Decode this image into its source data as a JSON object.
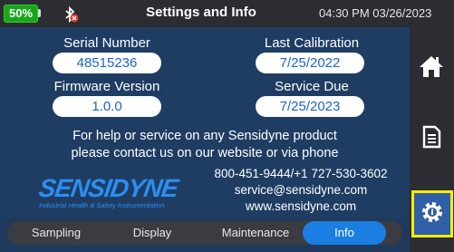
{
  "header": {
    "battery_percent": "50%",
    "battery_level": 0.5,
    "title": "Settings and Info",
    "clock": "04:30 PM 03/26/2023"
  },
  "device": {
    "serial_label": "Serial Number",
    "serial_value": "48515236",
    "calibration_label": "Last Calibration",
    "calibration_value": "7/25/2022",
    "firmware_label": "Firmware Version",
    "firmware_value": "1.0.0",
    "service_label": "Service Due",
    "service_value": "7/25/2023"
  },
  "help": {
    "line1": "For help or service on any Sensidyne product",
    "line2": "please contact us on our website or via phone"
  },
  "logo": {
    "name": "SENSIDYNE",
    "tagline": "Industrial Health & Safety Instrumentation"
  },
  "contact": {
    "phone": "800-451-9444/+1 727-530-3602",
    "email": "service@sensidyne.com",
    "website": "www.sensidyne.com"
  },
  "sidebar": {
    "icons": [
      "home-icon",
      "document-icon",
      "settings-info-icon"
    ]
  },
  "tabs": [
    {
      "label": "Sampling"
    },
    {
      "label": "Display"
    },
    {
      "label": "Maintenance"
    },
    {
      "label": "Info"
    }
  ],
  "colors": {
    "accent": "#1a7fe0",
    "highlight": "#ffee00",
    "battery": "#1aa51a"
  }
}
